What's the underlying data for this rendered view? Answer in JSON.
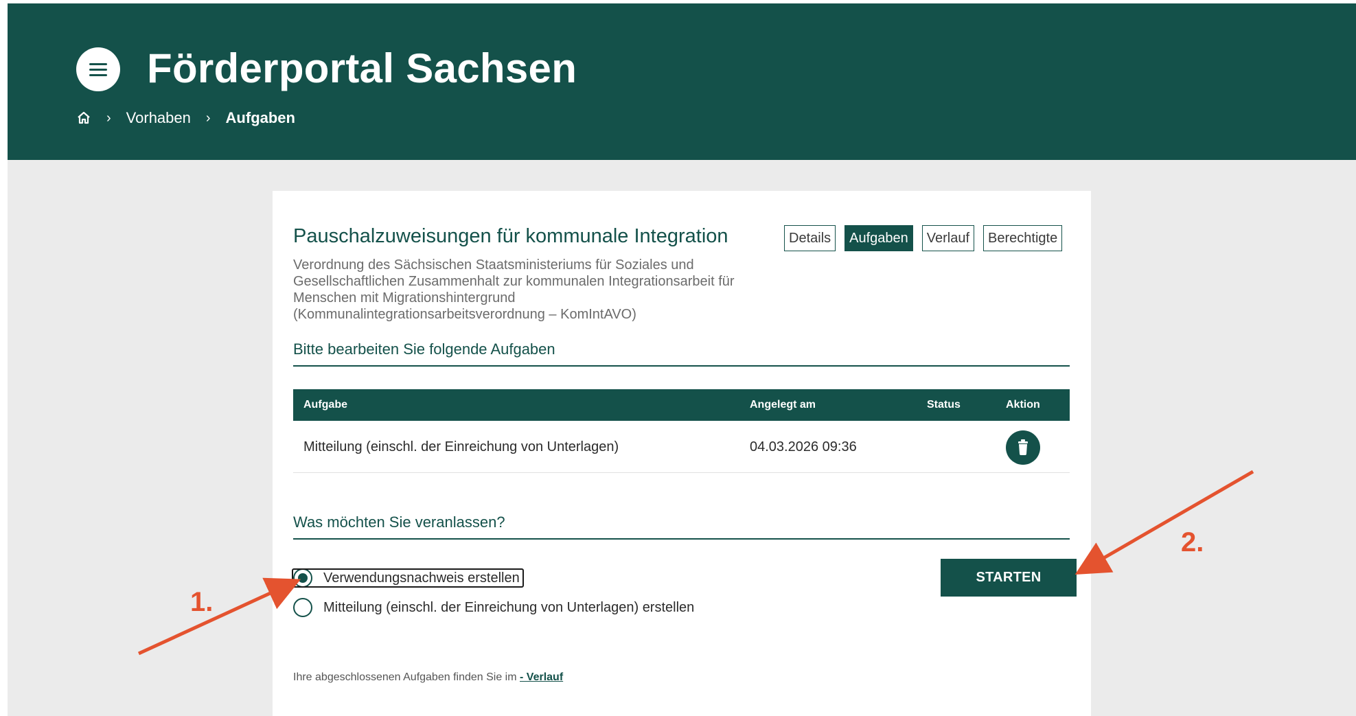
{
  "header": {
    "title": "Förderportal Sachsen",
    "breadcrumb": {
      "home_icon": "home-icon",
      "items": [
        "Vorhaben",
        "Aufgaben"
      ]
    }
  },
  "card": {
    "title": "Pauschalzuweisungen für kommunale Integration",
    "description_lines": [
      "Verordnung des Sächsischen Staatsministeriums für Soziales und",
      "Gesellschaftlichen Zusammenhalt zur kommunalen Integrationsarbeit für",
      "Menschen mit Migrationshintergrund",
      "(Kommunalintegrationsarbeitsverordnung – KomIntAVO)"
    ],
    "tabs": [
      {
        "label": "Details",
        "active": false
      },
      {
        "label": "Aufgaben",
        "active": true
      },
      {
        "label": "Verlauf",
        "active": false
      },
      {
        "label": "Berechtigte",
        "active": false
      }
    ],
    "tasks_heading": "Bitte bearbeiten Sie folgende Aufgaben",
    "table": {
      "headers": [
        "Aufgabe",
        "Angelegt am",
        "Status",
        "Aktion"
      ],
      "rows": [
        {
          "aufgabe": "Mitteilung (einschl. der Einreichung von Unterlagen)",
          "angelegt_am": "04.03.2026 09:36",
          "status": "",
          "action_icon": "trash-icon"
        }
      ]
    },
    "action_heading": "Was möchten Sie veranlassen?",
    "options": [
      {
        "label": "Verwendungsnachweis erstellen",
        "checked": true
      },
      {
        "label": "Mitteilung (einschl. der Einreichung von Unterlagen) erstellen",
        "checked": false
      }
    ],
    "start_label": "STARTEN",
    "footer_text": "Ihre abgeschlossenen Aufgaben finden Sie im",
    "footer_link": "- Verlauf"
  },
  "annotations": {
    "step1": "1.",
    "step2": "2.",
    "color": "#e4532f"
  },
  "colors": {
    "brand": "#14514a",
    "background": "#ebebeb"
  }
}
